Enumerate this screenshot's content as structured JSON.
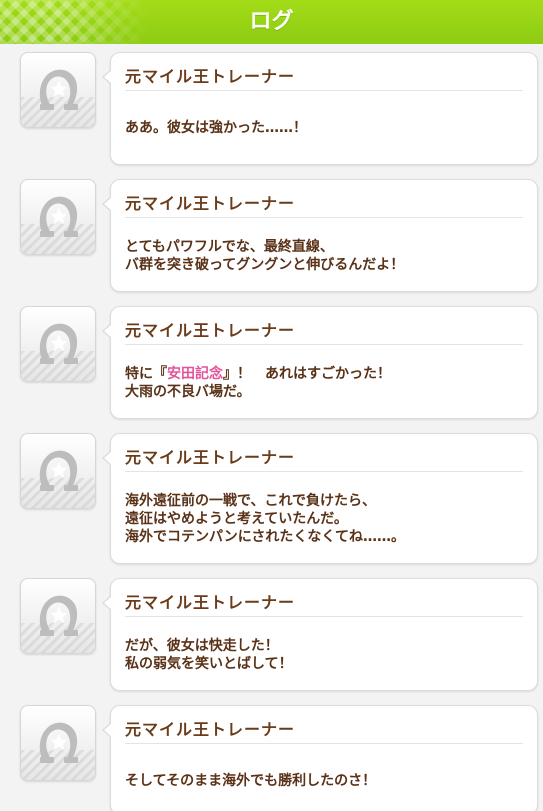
{
  "header": {
    "title": "ログ"
  },
  "entries": [
    {
      "speaker": "元マイル王トレーナー",
      "lines": [
        "ああ。彼女は強かった……！"
      ]
    },
    {
      "speaker": "元マイル王トレーナー",
      "lines": [
        "とてもパワフルでな、最終直線、",
        "バ群を突き破ってグングンと伸びるんだよ！"
      ]
    },
    {
      "speaker": "元マイル王トレーナー",
      "line1_pre": "特に『",
      "line1_highlight": "安田記念",
      "line1_post": "』！　あれはすごかった！",
      "lines": [
        "大雨の不良バ場だ。"
      ]
    },
    {
      "speaker": "元マイル王トレーナー",
      "lines": [
        "海外遠征前の一戦で、これで負けたら、",
        "遠征はやめようと考えていたんだ。",
        "海外でコテンパンにされたくなくてね……。"
      ]
    },
    {
      "speaker": "元マイル王トレーナー",
      "lines": [
        "だが、彼女は快走した！",
        "私の弱気を笑いとばして！"
      ]
    },
    {
      "speaker": "元マイル王トレーナー",
      "lines": [
        "そしてそのまま海外でも勝利したのさ！"
      ]
    }
  ],
  "colors": {
    "header": "#8ccc12",
    "speaker": "#6b3b1a",
    "highlight": "#e3539a"
  },
  "icons": {
    "avatar": "horseshoe-star-icon"
  }
}
